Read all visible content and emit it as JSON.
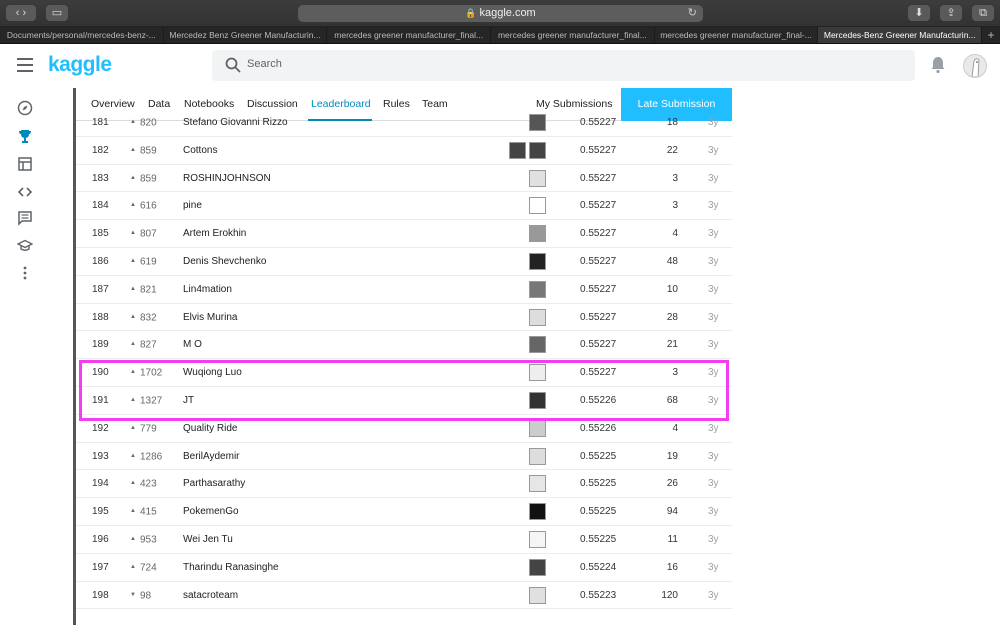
{
  "browser": {
    "url": "kaggle.com",
    "tabs": [
      {
        "label": "Documents/personal/mercedes-benz-...",
        "active": false
      },
      {
        "label": "Mercedez Benz Greener Manufacturin...",
        "active": false
      },
      {
        "label": "mercedes greener manufacturer_final...",
        "active": false
      },
      {
        "label": "mercedes greener manufacturer_final...",
        "active": false
      },
      {
        "label": "mercedes greener manufacturer_final-...",
        "active": false
      },
      {
        "label": "Mercedes-Benz Greener Manufacturin...",
        "active": true
      }
    ]
  },
  "header": {
    "logo": "kaggle",
    "search_placeholder": "Search"
  },
  "competition_nav": {
    "tabs": [
      "Overview",
      "Data",
      "Notebooks",
      "Discussion",
      "Leaderboard",
      "Rules",
      "Team"
    ],
    "active_tab": "Leaderboard",
    "my_submissions": "My Submissions",
    "late_submission": "Late Submission"
  },
  "leaderboard": {
    "rows": [
      {
        "rank": "181",
        "dir": "up",
        "change": "820",
        "team": "Stefano Giovanni Rizzo",
        "score": "0.55227",
        "entries": "18",
        "last": "3y",
        "avatars": 1
      },
      {
        "rank": "182",
        "dir": "up",
        "change": "859",
        "team": "Cottons",
        "score": "0.55227",
        "entries": "22",
        "last": "3y",
        "avatars": 2
      },
      {
        "rank": "183",
        "dir": "up",
        "change": "859",
        "team": "ROSHINJOHNSON",
        "score": "0.55227",
        "entries": "3",
        "last": "3y",
        "avatars": 1
      },
      {
        "rank": "184",
        "dir": "up",
        "change": "616",
        "team": "pine",
        "score": "0.55227",
        "entries": "3",
        "last": "3y",
        "avatars": 1
      },
      {
        "rank": "185",
        "dir": "up",
        "change": "807",
        "team": "Artem Erokhin",
        "score": "0.55227",
        "entries": "4",
        "last": "3y",
        "avatars": 1
      },
      {
        "rank": "186",
        "dir": "up",
        "change": "619",
        "team": "Denis Shevchenko",
        "score": "0.55227",
        "entries": "48",
        "last": "3y",
        "avatars": 1
      },
      {
        "rank": "187",
        "dir": "up",
        "change": "821",
        "team": "Lin4mation",
        "score": "0.55227",
        "entries": "10",
        "last": "3y",
        "avatars": 1
      },
      {
        "rank": "188",
        "dir": "up",
        "change": "832",
        "team": "Elvis Murina",
        "score": "0.55227",
        "entries": "28",
        "last": "3y",
        "avatars": 1
      },
      {
        "rank": "189",
        "dir": "up",
        "change": "827",
        "team": "M O",
        "score": "0.55227",
        "entries": "21",
        "last": "3y",
        "avatars": 1
      },
      {
        "rank": "190",
        "dir": "up",
        "change": "1702",
        "team": "Wuqiong Luo",
        "score": "0.55227",
        "entries": "3",
        "last": "3y",
        "avatars": 1
      },
      {
        "rank": "191",
        "dir": "up",
        "change": "1327",
        "team": "JT",
        "score": "0.55226",
        "entries": "68",
        "last": "3y",
        "avatars": 1
      },
      {
        "rank": "192",
        "dir": "up",
        "change": "779",
        "team": "Quality Ride",
        "score": "0.55226",
        "entries": "4",
        "last": "3y",
        "avatars": 1
      },
      {
        "rank": "193",
        "dir": "up",
        "change": "1286",
        "team": "BerilAydemir",
        "score": "0.55225",
        "entries": "19",
        "last": "3y",
        "avatars": 1
      },
      {
        "rank": "194",
        "dir": "up",
        "change": "423",
        "team": "Parthasarathy",
        "score": "0.55225",
        "entries": "26",
        "last": "3y",
        "avatars": 1
      },
      {
        "rank": "195",
        "dir": "up",
        "change": "415",
        "team": "PokemenGo",
        "score": "0.55225",
        "entries": "94",
        "last": "3y",
        "avatars": 1
      },
      {
        "rank": "196",
        "dir": "up",
        "change": "953",
        "team": "Wei Jen Tu",
        "score": "0.55225",
        "entries": "11",
        "last": "3y",
        "avatars": 1
      },
      {
        "rank": "197",
        "dir": "up",
        "change": "724",
        "team": "Tharindu Ranasinghe",
        "score": "0.55224",
        "entries": "16",
        "last": "3y",
        "avatars": 1
      },
      {
        "rank": "198",
        "dir": "down",
        "change": "98",
        "team": "satacroteam",
        "score": "0.55223",
        "entries": "120",
        "last": "3y",
        "avatars": 1
      }
    ]
  },
  "colors": {
    "kaggle_blue": "#20beff",
    "active_tab": "#008abc",
    "highlight": "#f23df0"
  }
}
